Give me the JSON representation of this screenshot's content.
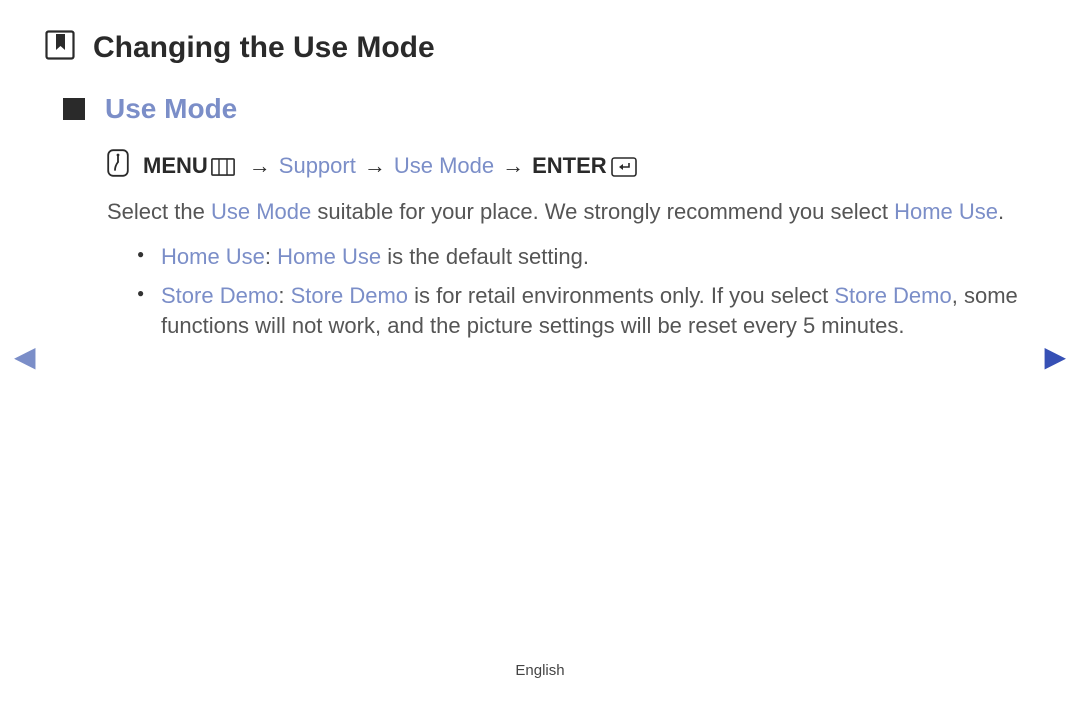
{
  "title": "Changing the Use Mode",
  "section": "Use Mode",
  "menupath": {
    "menu": "MENU",
    "arrow": "→",
    "support": "Support",
    "useMode": "Use Mode",
    "enter": "ENTER"
  },
  "intro": {
    "pre": "Select the ",
    "useMode": "Use Mode",
    "mid": " suitable for your place. We strongly recommend you select ",
    "homeUse": "Home Use",
    "post": "."
  },
  "bullets": {
    "homeUse": {
      "label": "Home Use",
      "sep": ": ",
      "label2": "Home Use",
      "rest": " is the default setting."
    },
    "storeDemo": {
      "label": "Store Demo",
      "sep": ": ",
      "label2": "Store Demo",
      "mid": " is for retail environments only. If you select ",
      "label3": "Store Demo",
      "rest": ", some functions will not work, and the picture settings will be reset every 5 minutes."
    }
  },
  "nav": {
    "prev": "◀",
    "next": "▶"
  },
  "footer": "English"
}
